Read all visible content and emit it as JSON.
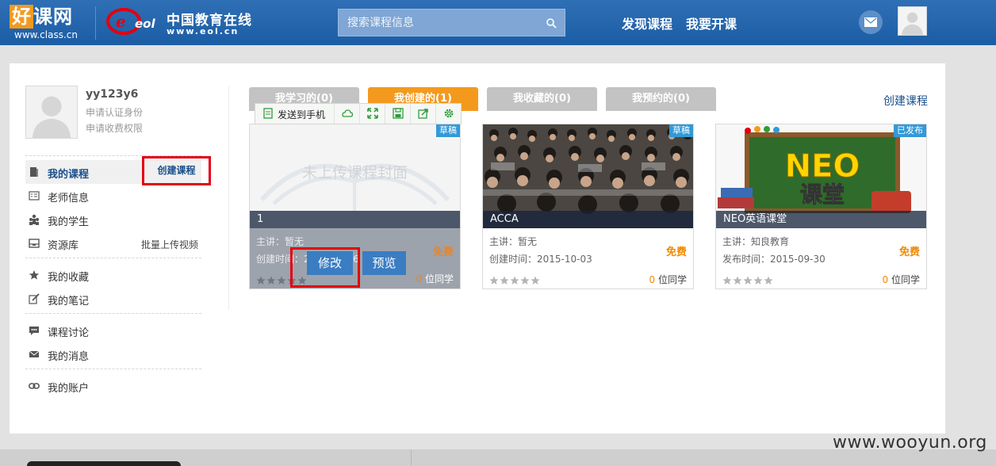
{
  "header": {
    "logo_primary": {
      "mark": "好",
      "text": "课网",
      "url": "www.class.cn"
    },
    "logo_secondary": {
      "mark": "eol",
      "text": "中国教育在线",
      "url": "www.eol.cn"
    },
    "search": {
      "placeholder": "搜索课程信息"
    },
    "nav": {
      "discover": "发现课程",
      "teach": "我要开课"
    }
  },
  "profile": {
    "username": "yy123y6",
    "links": [
      "申请认证身份",
      "申请收费权限"
    ]
  },
  "sidebar": {
    "create_label": "创建课程",
    "items": [
      {
        "label": "我的课程",
        "icon": "book-icon"
      },
      {
        "label": "老师信息",
        "icon": "id-card-icon"
      },
      {
        "label": "我的学生",
        "icon": "students-icon"
      },
      {
        "label": "资源库",
        "icon": "inbox-icon",
        "extra": "批量上传视频"
      },
      {
        "label": "我的收藏",
        "icon": "star-icon"
      },
      {
        "label": "我的笔记",
        "icon": "note-icon"
      },
      {
        "label": "课程讨论",
        "icon": "chat-icon"
      },
      {
        "label": "我的消息",
        "icon": "envelope-icon"
      },
      {
        "label": "我的账户",
        "icon": "link-icon"
      }
    ]
  },
  "tabs": {
    "items": [
      "我学习的(0)",
      "我创建的(1)",
      "我收藏的(0)",
      "我预约的(0)"
    ],
    "active": 1,
    "create_link": "创建课程"
  },
  "toolbar": {
    "send_label": "发送到手机",
    "icons": [
      "cloud-icon",
      "expand-icon",
      "save-icon",
      "share-icon",
      "settings-icon"
    ]
  },
  "cards": [
    {
      "title": "1",
      "status": "草稿",
      "cover_placeholder": "未上传课程封面",
      "teacher": "主讲：暂无",
      "date": "创建时间：2015-10-06",
      "price": "免费",
      "students_count": "0",
      "students_suffix": "位同学",
      "rating": 0,
      "edit_label": "修改",
      "preview_label": "预览"
    },
    {
      "title": "ACCA",
      "status": "草稿",
      "teacher": "主讲：暂无",
      "date": "创建时间：2015-10-03",
      "price": "免费",
      "students_count": "0",
      "students_suffix": "位同学",
      "rating": 0
    },
    {
      "title": "NEO英语课堂",
      "status": "已发布",
      "cover_text": "NEO",
      "cover_subtext": "课堂",
      "teacher": "主讲：知良教育",
      "date": "发布时间：2015-09-30",
      "price": "免费",
      "students_count": "0",
      "students_suffix": "位同学",
      "rating": 0
    }
  ],
  "watermark": "www.wooyun.org",
  "colors": {
    "header_blue": "#1b5da5",
    "accent_orange": "#f39a1e",
    "badge_blue": "#3399d8",
    "highlight_red": "#e3000f",
    "link_blue": "#1a4f8b"
  }
}
